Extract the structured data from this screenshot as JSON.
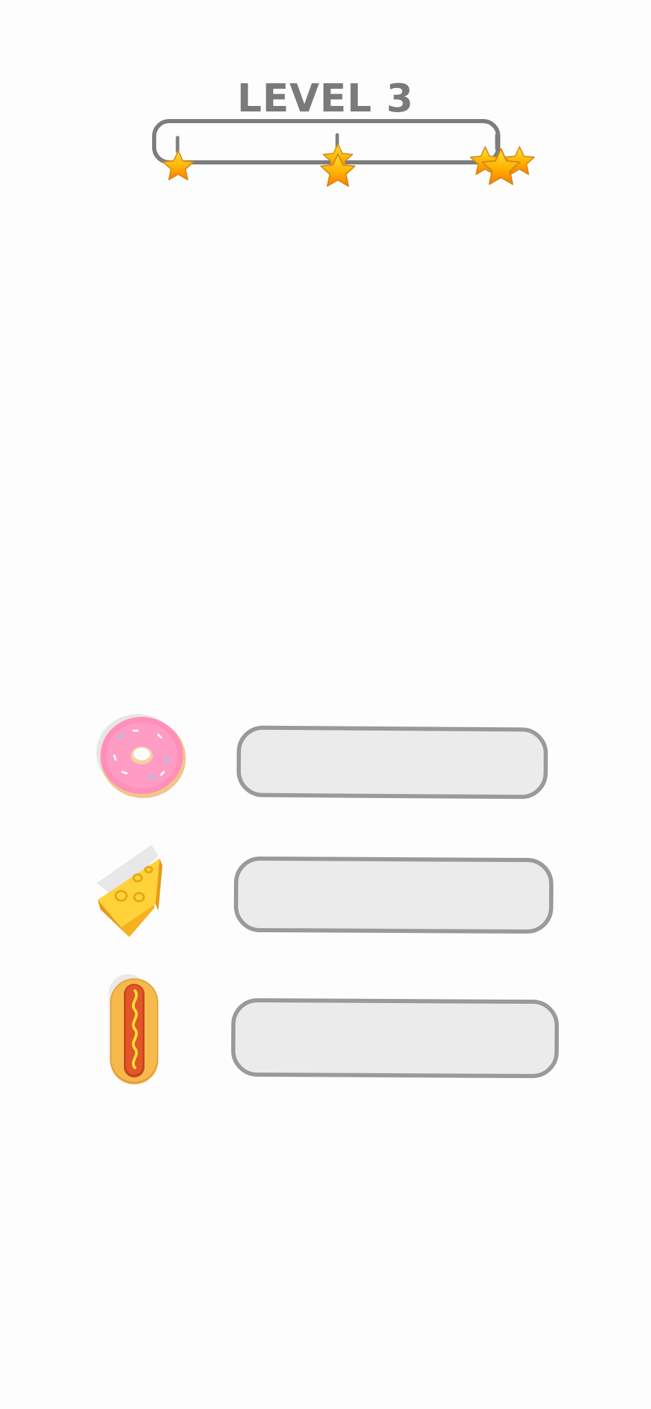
{
  "level": {
    "title": "LEVEL 3",
    "progress_fraction": 0,
    "milestones": [
      {
        "stars": 1
      },
      {
        "stars": 2
      },
      {
        "stars": 3
      }
    ]
  },
  "rows": [
    {
      "item": "donut-icon",
      "answer": ""
    },
    {
      "item": "cheese-icon",
      "answer": ""
    },
    {
      "item": "hotdog-icon",
      "answer": ""
    }
  ],
  "colors": {
    "title": "#7a7a7a",
    "progress_track": "#7d7d7d",
    "star_top": "#ffd32a",
    "star_bottom": "#ff8a00",
    "slot_fill": "#ebebeb",
    "slot_border": "#9a9a9a"
  }
}
